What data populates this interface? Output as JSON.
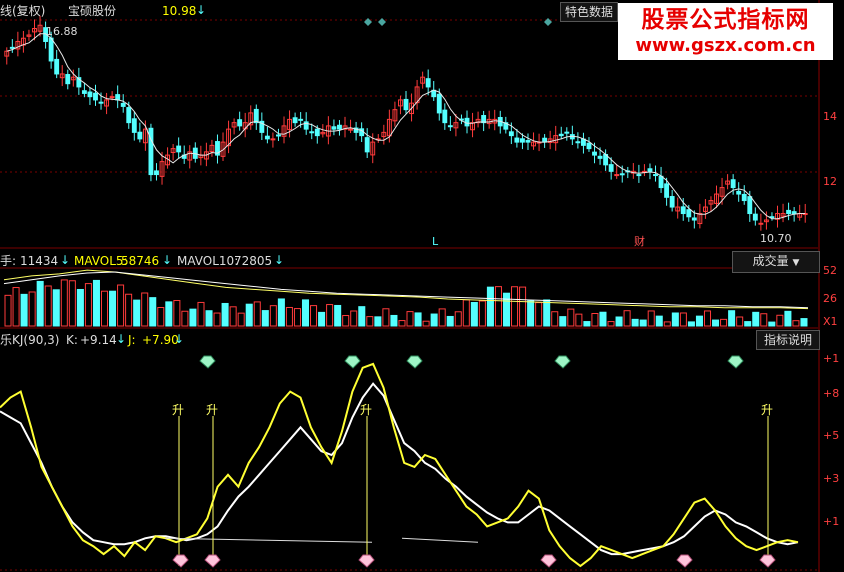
{
  "price_panel": {
    "title": "线(复权)",
    "stock_name": "宝硕股份",
    "last_price": "10.98",
    "last_arrow": "↓",
    "feature_button": "特色数据",
    "high_marker": "16.88",
    "low_marker": "10.70",
    "y_ticks": [
      "14",
      "12"
    ],
    "markers": [
      "L",
      "财"
    ],
    "colors": {
      "up": "#ff3b3b",
      "down": "#54ffff",
      "ma": "#e8e8e8",
      "grid": "#7a0000",
      "axis": "#8b0000"
    }
  },
  "watermark": {
    "line1": "股票公式指标网",
    "line2": "www.gszx.com.cn"
  },
  "volume_panel": {
    "label_prefix": "手:",
    "volume": "11434",
    "mavol5_label": "MAVOL5:",
    "mavol5": "58746",
    "mavol10_label": "MAVOL10:",
    "mavol10": "72805",
    "arrow": "↓",
    "button": "成交量",
    "y_ticks": [
      "52",
      "26",
      "X1"
    ]
  },
  "indicator_panel": {
    "name": "乐KJ(90,3)",
    "k_label": "K:",
    "k_value": "+9.14",
    "j_label": "J:",
    "j_value": "+7.90",
    "arrow": "↓",
    "button": "指标说明",
    "y_ticks": [
      "+1",
      "+8",
      "+5",
      "+3",
      "+1"
    ],
    "signal_label": "升"
  },
  "chart_data": [
    {
      "type": "candlestick",
      "title": "宝硕股份",
      "ylim": [
        10,
        16.9
      ],
      "close": [
        16.0,
        16.1,
        16.3,
        16.4,
        16.5,
        16.7,
        16.8,
        16.3,
        15.7,
        15.3,
        15.3,
        15.0,
        15.2,
        14.9,
        14.7,
        14.6,
        14.5,
        14.4,
        14.5,
        14.6,
        14.5,
        14.3,
        13.8,
        13.5,
        13.3,
        13.6,
        12.2,
        12.2,
        12.6,
        12.8,
        13.0,
        12.9,
        12.7,
        12.9,
        12.7,
        12.8,
        12.9,
        13.1,
        12.8,
        13.2,
        13.6,
        13.8,
        13.7,
        13.8,
        14.1,
        13.8,
        13.5,
        13.3,
        13.3,
        13.4,
        13.7,
        13.9,
        13.8,
        13.9,
        13.6,
        13.5,
        13.4,
        13.5,
        13.7,
        13.6,
        13.6,
        13.7,
        13.6,
        13.5,
        13.4,
        12.9,
        13.2,
        13.3,
        13.5,
        13.9,
        14.2,
        14.5,
        14.2,
        14.4,
        14.9,
        15.2,
        14.9,
        14.6,
        14.1,
        13.8,
        13.7,
        13.8,
        13.9,
        13.7,
        13.8,
        13.9,
        13.8,
        13.9,
        13.9,
        13.7,
        13.6,
        13.4,
        13.2,
        13.2,
        13.2,
        13.2,
        13.2,
        13.2,
        13.3,
        13.4,
        13.4,
        13.5,
        13.3,
        13.2,
        13.1,
        13.0,
        12.8,
        12.7,
        12.5,
        12.3,
        12.2,
        12.2,
        12.3,
        12.3,
        12.2,
        12.3,
        12.3,
        12.2,
        11.8,
        11.5,
        11.2,
        11.2,
        11.0,
        10.9,
        10.8,
        11.0,
        11.2,
        11.4,
        11.6,
        11.8,
        12.0,
        11.8,
        11.6,
        11.4,
        11.0,
        10.8,
        10.7,
        10.8,
        10.9,
        11.0,
        11.0,
        11.0,
        11.0,
        11.0,
        11.0
      ]
    },
    {
      "type": "bar",
      "title": "成交量",
      "series": [
        {
          "name": "MAVOL5",
          "values": [
            48,
            52,
            54,
            58,
            56,
            52,
            48,
            44,
            40,
            38,
            36,
            34,
            33,
            32,
            31,
            30,
            28,
            27,
            26,
            25,
            24,
            23,
            22,
            21,
            20,
            20,
            19,
            19,
            19,
            18
          ]
        },
        {
          "name": "MAVOL10",
          "values": [
            44,
            48,
            52,
            55,
            56,
            53,
            50,
            47,
            44,
            41,
            38,
            36,
            34,
            33,
            32,
            31,
            30,
            29,
            28,
            27,
            26,
            25,
            24,
            23,
            22,
            21,
            21,
            20,
            20,
            19
          ]
        }
      ],
      "ylim": [
        0,
        56
      ]
    },
    {
      "type": "line",
      "title": "乐KJ(90,3)",
      "ylim": [
        0,
        110
      ],
      "series": [
        {
          "name": "K",
          "values": [
            78,
            75,
            72,
            62,
            52,
            40,
            30,
            22,
            17,
            13,
            12,
            11,
            11,
            12,
            14,
            15,
            15,
            14,
            13,
            14,
            16,
            20,
            28,
            35,
            40,
            46,
            52,
            58,
            64,
            70,
            64,
            58,
            56,
            62,
            75,
            85,
            92,
            86,
            74,
            62,
            58,
            52,
            49,
            44,
            40,
            35,
            31,
            27,
            24,
            22,
            22,
            26,
            30,
            28,
            24,
            20,
            16,
            12,
            8,
            6,
            6,
            7,
            8,
            9,
            10,
            12,
            15,
            20,
            25,
            28,
            26,
            22,
            20,
            17,
            14,
            12,
            11,
            12
          ]
        },
        {
          "name": "J",
          "values": [
            80,
            85,
            88,
            70,
            50,
            40,
            30,
            20,
            13,
            10,
            6,
            10,
            5,
            12,
            8,
            15,
            14,
            12,
            14,
            16,
            24,
            40,
            46,
            40,
            52,
            60,
            70,
            82,
            88,
            85,
            70,
            60,
            52,
            68,
            88,
            100,
            102,
            90,
            70,
            52,
            50,
            56,
            54,
            46,
            38,
            30,
            26,
            20,
            22,
            24,
            30,
            38,
            34,
            18,
            10,
            4,
            0,
            4,
            10,
            8,
            6,
            4,
            6,
            8,
            10,
            16,
            24,
            32,
            34,
            28,
            20,
            14,
            10,
            8,
            10,
            12,
            13,
            12
          ]
        }
      ]
    }
  ]
}
